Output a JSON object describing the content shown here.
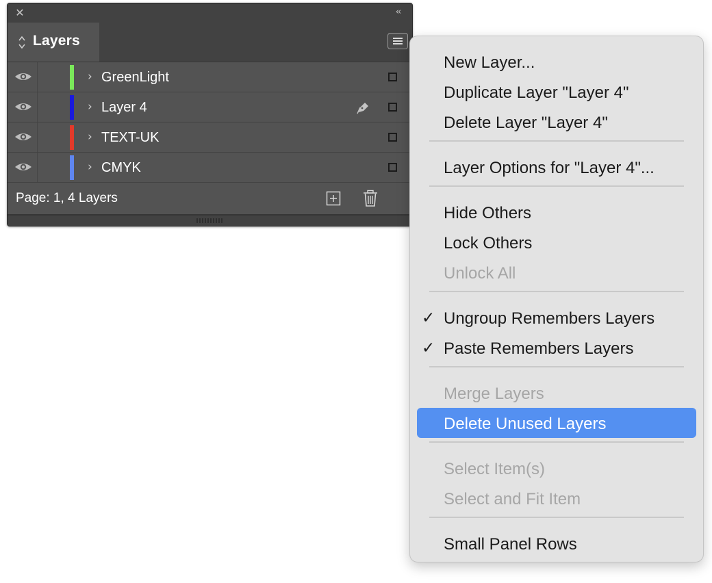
{
  "panel": {
    "close_icon": "close-icon",
    "collapse_icon": "collapse-double-chevron-icon",
    "tab_label": "Layers",
    "layers": [
      {
        "name": "GreenLight",
        "color": "#7ae85a",
        "visible": true,
        "pen": false
      },
      {
        "name": "Layer 4",
        "color": "#1a1adc",
        "visible": true,
        "pen": true
      },
      {
        "name": "TEXT-UK",
        "color": "#e33a2a",
        "visible": true,
        "pen": false
      },
      {
        "name": "CMYK",
        "color": "#5f86f0",
        "visible": true,
        "pen": false
      }
    ],
    "footer_text": "Page: 1, 4 Layers"
  },
  "menu": {
    "items": [
      {
        "label": "New Layer...",
        "enabled": true,
        "checked": false,
        "highlighted": false
      },
      {
        "label": "Duplicate Layer \"Layer 4\"",
        "enabled": true,
        "checked": false,
        "highlighted": false
      },
      {
        "label": "Delete Layer \"Layer 4\"",
        "enabled": true,
        "checked": false,
        "highlighted": false
      },
      {
        "label": "Layer Options for \"Layer 4\"...",
        "enabled": true,
        "checked": false,
        "highlighted": false
      },
      {
        "label": "Hide Others",
        "enabled": true,
        "checked": false,
        "highlighted": false
      },
      {
        "label": "Lock Others",
        "enabled": true,
        "checked": false,
        "highlighted": false
      },
      {
        "label": "Unlock All",
        "enabled": false,
        "checked": false,
        "highlighted": false
      },
      {
        "label": "Ungroup Remembers Layers",
        "enabled": true,
        "checked": true,
        "highlighted": false
      },
      {
        "label": "Paste Remembers Layers",
        "enabled": true,
        "checked": true,
        "highlighted": false
      },
      {
        "label": "Merge Layers",
        "enabled": false,
        "checked": false,
        "highlighted": false
      },
      {
        "label": "Delete Unused Layers",
        "enabled": true,
        "checked": false,
        "highlighted": true
      },
      {
        "label": "Select Item(s)",
        "enabled": false,
        "checked": false,
        "highlighted": false
      },
      {
        "label": "Select and Fit Item",
        "enabled": false,
        "checked": false,
        "highlighted": false
      },
      {
        "label": "Small Panel Rows",
        "enabled": true,
        "checked": false,
        "highlighted": false
      }
    ],
    "check_glyph": "✓",
    "highlight_color": "#5490f1"
  }
}
